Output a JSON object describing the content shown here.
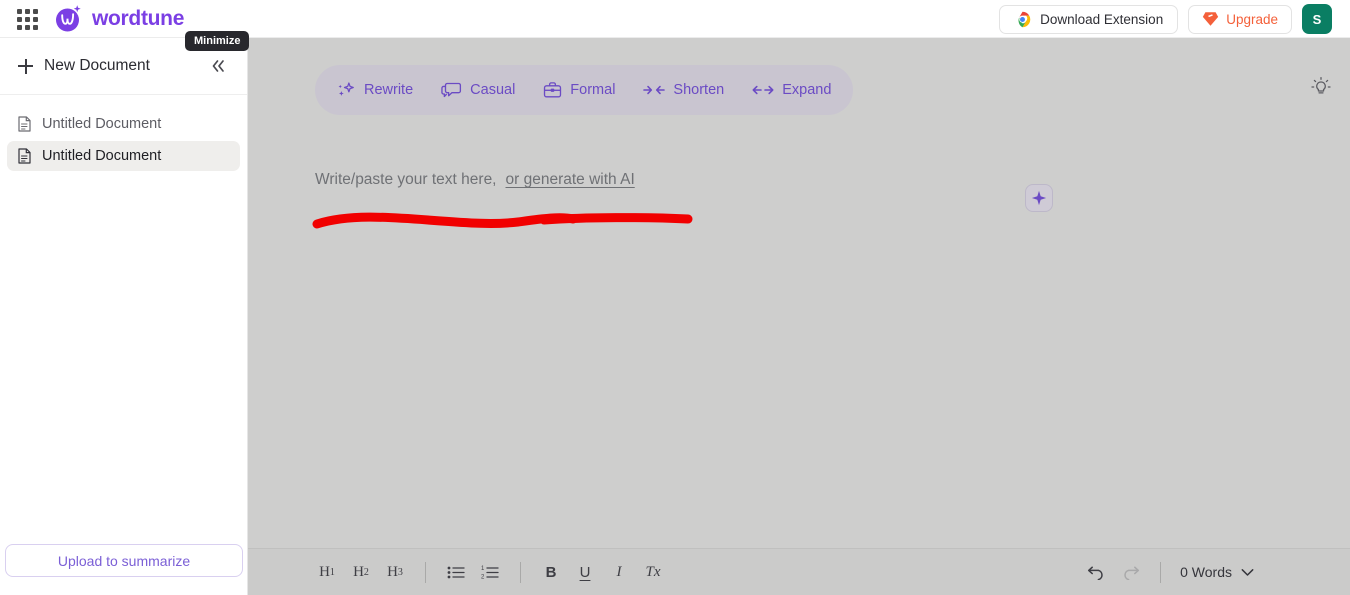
{
  "topbar": {
    "apps_icon": "apps-grid-icon",
    "brand": "wordtune",
    "download_extension": "Download Extension",
    "download_icon": "chrome-icon",
    "upgrade": "Upgrade",
    "upgrade_icon": "diamond-icon",
    "avatar_initial": "S",
    "avatar_color": "#0a7e63",
    "brand_color": "#7b3fe4",
    "upgrade_color": "#f4603a"
  },
  "tooltip": {
    "label": "Minimize"
  },
  "sidebar": {
    "new_document": "New Document",
    "new_document_icon": "plus-icon",
    "collapse_icon": "chevron-double-left-icon",
    "documents": [
      {
        "label": "Untitled Document",
        "icon": "document-icon",
        "active": false
      },
      {
        "label": "Untitled Document",
        "icon": "document-icon",
        "active": true
      }
    ],
    "upload_button": "Upload to summarize",
    "upload_color": "#7b5fd6"
  },
  "editor": {
    "background": "#cececd",
    "actions": [
      {
        "label": "Rewrite",
        "icon": "magic-sparkle-icon"
      },
      {
        "label": "Casual",
        "icon": "speech-bubbles-icon"
      },
      {
        "label": "Formal",
        "icon": "briefcase-icon"
      },
      {
        "label": "Shorten",
        "icon": "arrows-inward-icon"
      },
      {
        "label": "Expand",
        "icon": "arrows-outward-icon"
      }
    ],
    "action_color": "#6b4bc4",
    "placeholder": "Write/paste your text here,",
    "generate_link": "or generate with AI",
    "ai_chip_icon": "sparkle-star-icon",
    "bulb_icon": "lightbulb-icon",
    "annotation_color": "#f10000"
  },
  "bottombar": {
    "format_buttons": [
      {
        "label": "H",
        "sub": "1",
        "name": "heading-1-button"
      },
      {
        "label": "H",
        "sub": "2",
        "name": "heading-2-button"
      },
      {
        "label": "H",
        "sub": "3",
        "name": "heading-3-button"
      }
    ],
    "list_buttons": [
      {
        "icon": "bullet-list-icon",
        "name": "bullet-list-button"
      },
      {
        "icon": "numbered-list-icon",
        "name": "numbered-list-button"
      }
    ],
    "style_buttons": [
      {
        "label": "B",
        "name": "bold-button"
      },
      {
        "label": "U",
        "name": "underline-button"
      },
      {
        "label": "I",
        "name": "italic-button"
      },
      {
        "label": "Tx",
        "name": "clear-formatting-button"
      }
    ],
    "undo_icon": "undo-icon",
    "redo_icon": "redo-icon",
    "word_count": "0 Words",
    "word_count_chevron": "chevron-down-icon"
  }
}
